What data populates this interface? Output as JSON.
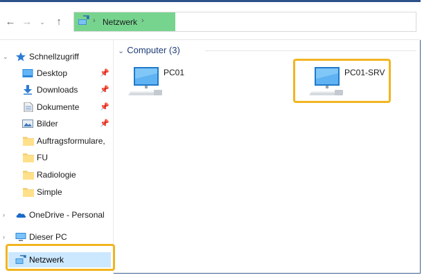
{
  "address_bar": {
    "location": "Netzwerk"
  },
  "sidebar": {
    "items": [
      {
        "label": "Schnellzugriff",
        "icon": "star-icon",
        "pinned": false,
        "expanded": true
      },
      {
        "label": "Desktop",
        "icon": "desktop-folder-icon",
        "pinned": true
      },
      {
        "label": "Downloads",
        "icon": "download-arrow-icon",
        "pinned": true
      },
      {
        "label": "Dokumente",
        "icon": "document-icon",
        "pinned": true
      },
      {
        "label": "Bilder",
        "icon": "pictures-icon",
        "pinned": true
      },
      {
        "label": "Auftragsformulare,",
        "icon": "folder-icon",
        "pinned": false
      },
      {
        "label": "FU",
        "icon": "folder-icon",
        "pinned": false
      },
      {
        "label": "Radiologie",
        "icon": "folder-icon",
        "pinned": false
      },
      {
        "label": "Simple",
        "icon": "folder-icon",
        "pinned": false
      },
      {
        "label": "OneDrive - Personal",
        "icon": "cloud-icon",
        "pinned": false
      },
      {
        "label": "Dieser PC",
        "icon": "computer-icon",
        "pinned": false
      },
      {
        "label": "Netzwerk",
        "icon": "network-icon",
        "pinned": false,
        "selected": true
      }
    ]
  },
  "main": {
    "group_header": "Computer (3)",
    "computers": [
      {
        "label": "PC01"
      },
      {
        "label": "PC01-SRV"
      }
    ]
  },
  "colors": {
    "highlight_box": "#f2b420",
    "address_crumb": "#77d48f",
    "selected_item": "#cce8ff",
    "group_header_text": "#1e3c78"
  }
}
